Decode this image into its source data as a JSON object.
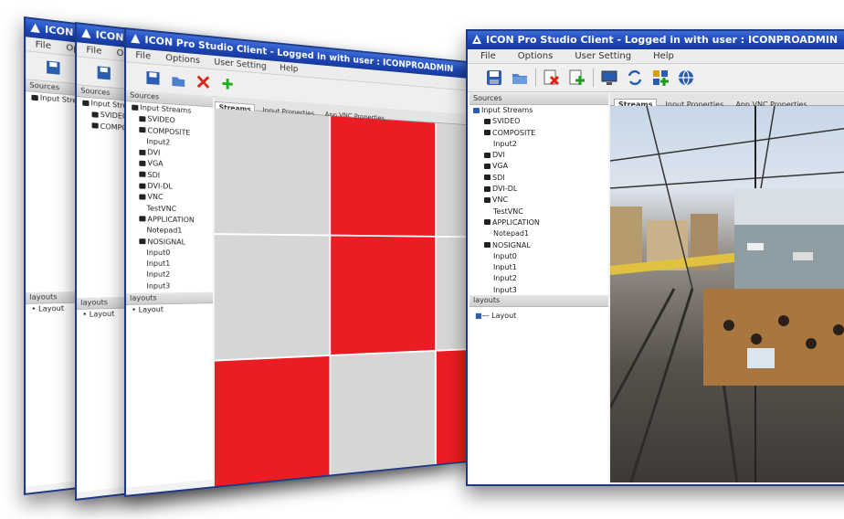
{
  "window_title": "ICON Pro Studio Client - Logged in with user : ICONPROADMIN",
  "back_titles": [
    "ICON Pro S",
    "ICON Pro S",
    "ICON Pro Studio Client - Logged in with user : ICONPROADMIN"
  ],
  "menu": [
    "File",
    "Options",
    "User Setting",
    "Help"
  ],
  "sources_label": "Sources",
  "layouts_label": "layouts",
  "layout_item": "Layout",
  "tabs": [
    "Streams",
    "Input Properties",
    "App VNC Properties"
  ],
  "tree": [
    {
      "label": "Input Streams",
      "level": 0
    },
    {
      "label": "SVIDEO",
      "level": 1
    },
    {
      "label": "COMPOSITE",
      "level": 1
    },
    {
      "label": "Input2",
      "level": 2
    },
    {
      "label": "DVI",
      "level": 1
    },
    {
      "label": "VGA",
      "level": 1
    },
    {
      "label": "SDI",
      "level": 1
    },
    {
      "label": "DVI-DL",
      "level": 1
    },
    {
      "label": "VNC",
      "level": 1
    },
    {
      "label": "TestVNC",
      "level": 2
    },
    {
      "label": "APPLICATION",
      "level": 1
    },
    {
      "label": "Notepad1",
      "level": 2
    },
    {
      "label": "NOSIGNAL",
      "level": 1
    },
    {
      "label": "Input0",
      "level": 2
    },
    {
      "label": "Input1",
      "level": 2
    },
    {
      "label": "Input2",
      "level": 2
    },
    {
      "label": "Input3",
      "level": 2
    }
  ],
  "colors": {
    "title_blue": "#1f47b8",
    "red_cell": "#ec1c24",
    "gray_cell": "#d6d6d6"
  }
}
